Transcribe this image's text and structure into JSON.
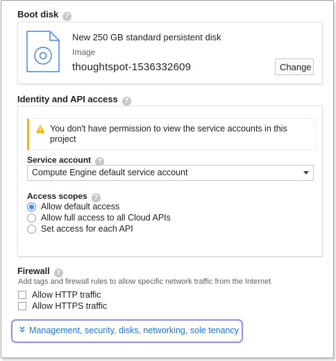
{
  "boot_disk": {
    "title": "Boot disk",
    "disk_name": "New 250 GB standard persistent disk",
    "image_label": "Image",
    "image_value": "thoughtspot-1536332609",
    "change_label": "Change"
  },
  "identity": {
    "title": "Identity and API access",
    "warning_text": "You don't have permission to view the service accounts in this project",
    "service_account_label": "Service account",
    "service_account_value": "Compute Engine default service account",
    "access_scopes_label": "Access scopes",
    "scopes": [
      {
        "label": "Allow default access",
        "selected": true
      },
      {
        "label": "Allow full access to all Cloud APIs",
        "selected": false
      },
      {
        "label": "Set access for each API",
        "selected": false
      }
    ]
  },
  "firewall": {
    "title": "Firewall",
    "description": "Add tags and firewall rules to allow specific network traffic from the Internet",
    "options": [
      {
        "label": "Allow HTTP traffic",
        "checked": false
      },
      {
        "label": "Allow HTTPS traffic",
        "checked": false
      }
    ]
  },
  "management": {
    "label": "Management, security, disks, networking, sole tenancy"
  },
  "icons": {
    "help": "help-circle-icon",
    "warning": "warning-icon",
    "disk": "disk-image-icon",
    "expand": "double-chevron-down-icon"
  },
  "colors": {
    "accent": "#4285f4",
    "link": "#1a73e8",
    "warning": "#f4b400",
    "highlight": "#8d92ee"
  }
}
